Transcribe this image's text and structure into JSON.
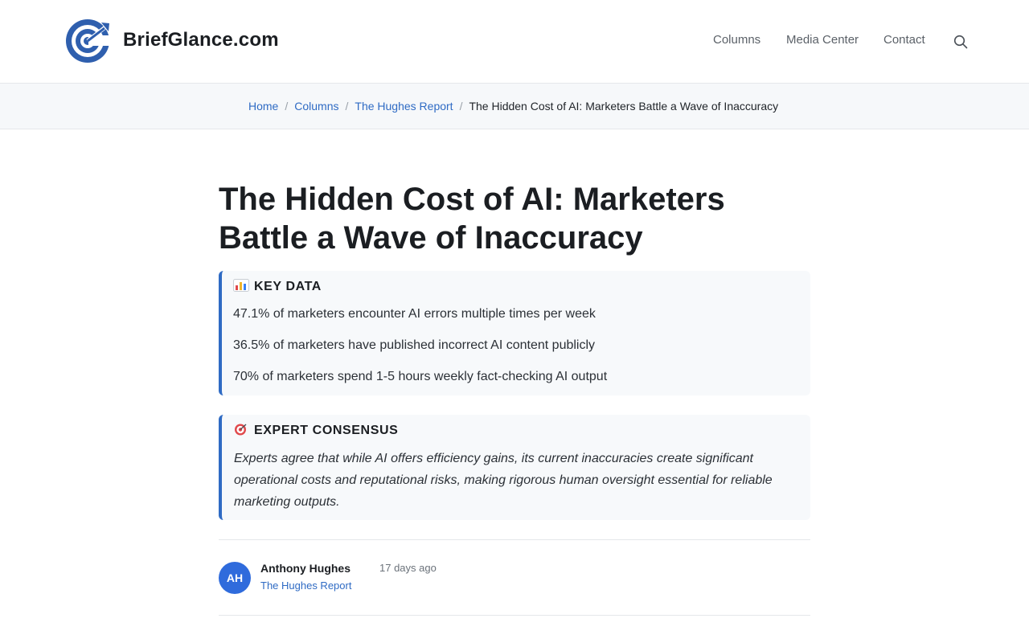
{
  "site": {
    "brand": "BriefGlance.com",
    "logo_icon": "target-arrow-logo",
    "accent_color": "#2f6bc4"
  },
  "nav": {
    "items": [
      {
        "label": "Columns"
      },
      {
        "label": "Media Center"
      },
      {
        "label": "Contact"
      }
    ],
    "search_icon": "search-icon"
  },
  "breadcrumb": {
    "items": [
      {
        "label": "Home"
      },
      {
        "label": "Columns"
      },
      {
        "label": "The Hughes Report"
      }
    ],
    "separator": "/",
    "current": "The Hidden Cost of AI: Marketers Battle a Wave of Inaccuracy"
  },
  "article": {
    "title": "The Hidden Cost of AI: Marketers Battle a Wave of Inaccuracy",
    "key_data": {
      "heading": "KEY DATA",
      "icon": "bar-chart-emoji",
      "items": [
        "47.1% of marketers encounter AI errors multiple times per week",
        "36.5% of marketers have published incorrect AI content publicly",
        "70% of marketers spend 1-5 hours weekly fact-checking AI output"
      ]
    },
    "expert_consensus": {
      "heading": "EXPERT CONSENSUS",
      "icon": "target-emoji",
      "text": "Experts agree that while AI offers efficiency gains, its current inaccuracies create significant operational costs and reputational risks, making rigorous human oversight essential for reliable marketing outputs."
    },
    "author": {
      "initials": "AH",
      "name": "Anthony Hughes",
      "column": "The Hughes Report",
      "published": "17 days ago",
      "avatar_color": "#2f6bdc"
    }
  }
}
